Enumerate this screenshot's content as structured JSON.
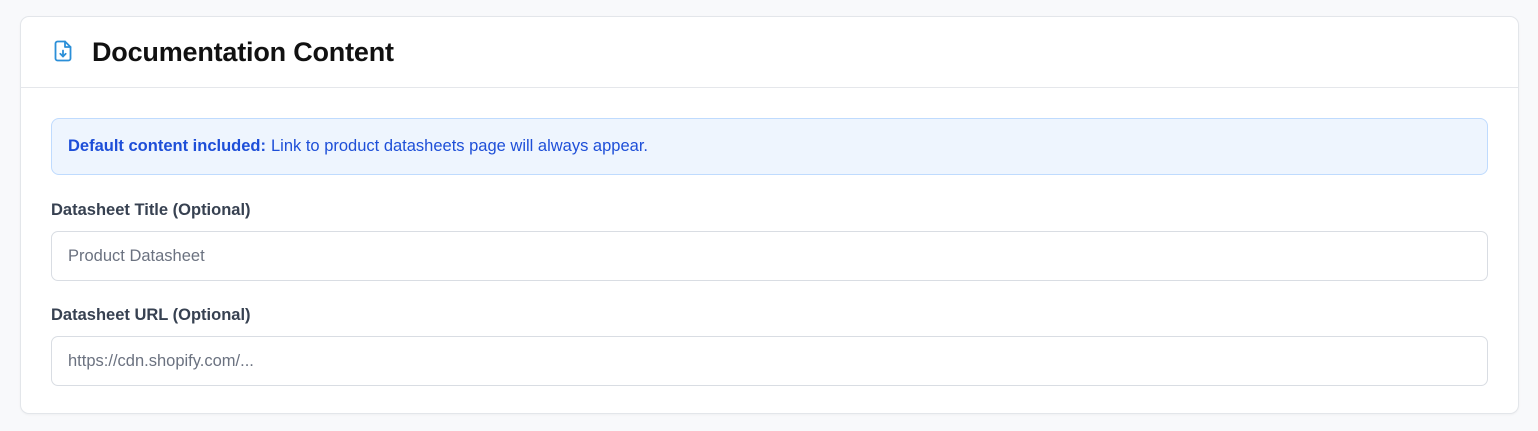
{
  "card": {
    "title": "Documentation Content",
    "icon": "file-download-icon",
    "accent_color": "#2b8fd8"
  },
  "info": {
    "strong": "Default content included:",
    "text": "Link to product datasheets page will always appear."
  },
  "fields": {
    "title": {
      "label": "Datasheet Title (Optional)",
      "value": "",
      "placeholder": "Product Datasheet"
    },
    "url": {
      "label": "Datasheet URL (Optional)",
      "value": "",
      "placeholder": "https://cdn.shopify.com/..."
    }
  }
}
